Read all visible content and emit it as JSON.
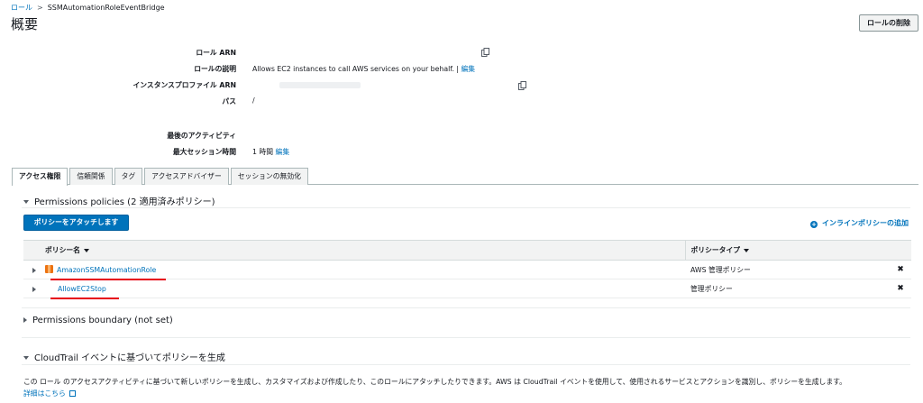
{
  "breadcrumb": {
    "parent": "ロール",
    "separator": ">",
    "current": "SSMAutomationRoleEventBridge"
  },
  "page_title": "概要",
  "delete_button": "ロールの削除",
  "summary": {
    "role_arn_label": "ロール ARN",
    "description_label": "ロールの説明",
    "description_value": "Allows EC2 instances to call AWS services on your behalf. |",
    "description_edit": "編集",
    "instance_profile_label": "インスタンスプロファイル ARN",
    "path_label": "パス",
    "path_value": "/",
    "last_activity_label": "最後のアクティビティ",
    "max_session_label": "最大セッション時間",
    "max_session_value": "1 時間",
    "max_session_edit": "編集"
  },
  "tabs": [
    "アクセス権限",
    "信頼関係",
    "タグ",
    "アクセスアドバイザー",
    "セッションの無効化"
  ],
  "permissions": {
    "heading": "Permissions policies (2 適用済みポリシー)",
    "attach_button": "ポリシーをアタッチします",
    "add_inline": "インラインポリシーの追加",
    "columns": {
      "name": "ポリシー名",
      "type": "ポリシータイプ"
    },
    "rows": [
      {
        "name": "AmazonSSMAutomationRole",
        "type": "AWS 管理ポリシー",
        "icon": "managed-policy-icon"
      },
      {
        "name": "AllowEC2Stop",
        "type": "管理ポリシー",
        "icon": ""
      }
    ],
    "remove_glyph": "✖"
  },
  "boundary": {
    "heading": "Permissions boundary (not set)"
  },
  "cloudtrail": {
    "heading": "CloudTrail イベントに基づいてポリシーを生成",
    "description": "この ロール のアクセスアクティビティに基づいて新しいポリシーを生成し、カスタマイズおよび作成したり、このロールにアタッチしたりできます。AWS は CloudTrail イベントを使用して、使用されるサービスとアクションを識別し、ポリシーを生成します。",
    "learn_more": "詳細はこちら"
  },
  "colors": {
    "link": "#0073bb",
    "primary": "#0073bb",
    "highlight": "#e60012",
    "icon": "#ec7211"
  }
}
